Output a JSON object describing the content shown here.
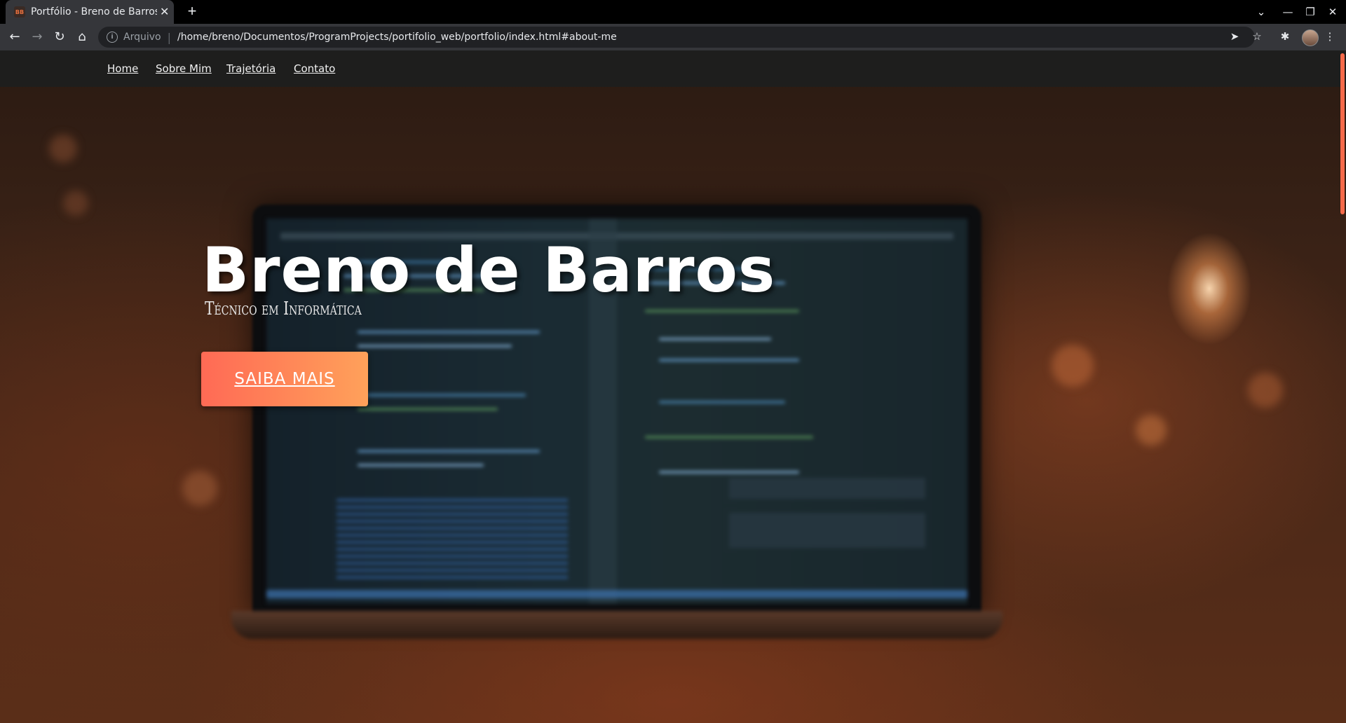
{
  "browser": {
    "tab": {
      "favicon_text": "BB",
      "title": "Portfólio - Breno de Barros",
      "close_glyph": "✕"
    },
    "new_tab_glyph": "+",
    "window_controls": {
      "tab_search": "⌄",
      "minimize": "—",
      "restore": "❐",
      "close": "✕"
    },
    "nav_icons": {
      "back": "←",
      "forward": "→",
      "reload": "↻",
      "home": "⌂"
    },
    "omnibox": {
      "info_glyph": "i",
      "scheme_label": "Arquivo",
      "url": "/home/breno/Documentos/ProgramProjects/portifolio_web/portfolio/index.html#about-me"
    },
    "right_icons": {
      "send": "➤",
      "bookmark": "☆",
      "extensions": "✱",
      "menu": "⋮"
    }
  },
  "site": {
    "nav": [
      {
        "label": "Home"
      },
      {
        "label": "Sobre Mim"
      },
      {
        "label": "Trajetória"
      },
      {
        "label": "Contato"
      }
    ],
    "hero": {
      "title": "Breno de Barros",
      "subtitle": "Técnico em Informática",
      "cta_label": "SAIBA MAIS"
    },
    "colors": {
      "cta_gradient_start": "#ff6a55",
      "cta_gradient_end": "#ffa15a",
      "scroll_thumb": "#f56a4a"
    }
  }
}
